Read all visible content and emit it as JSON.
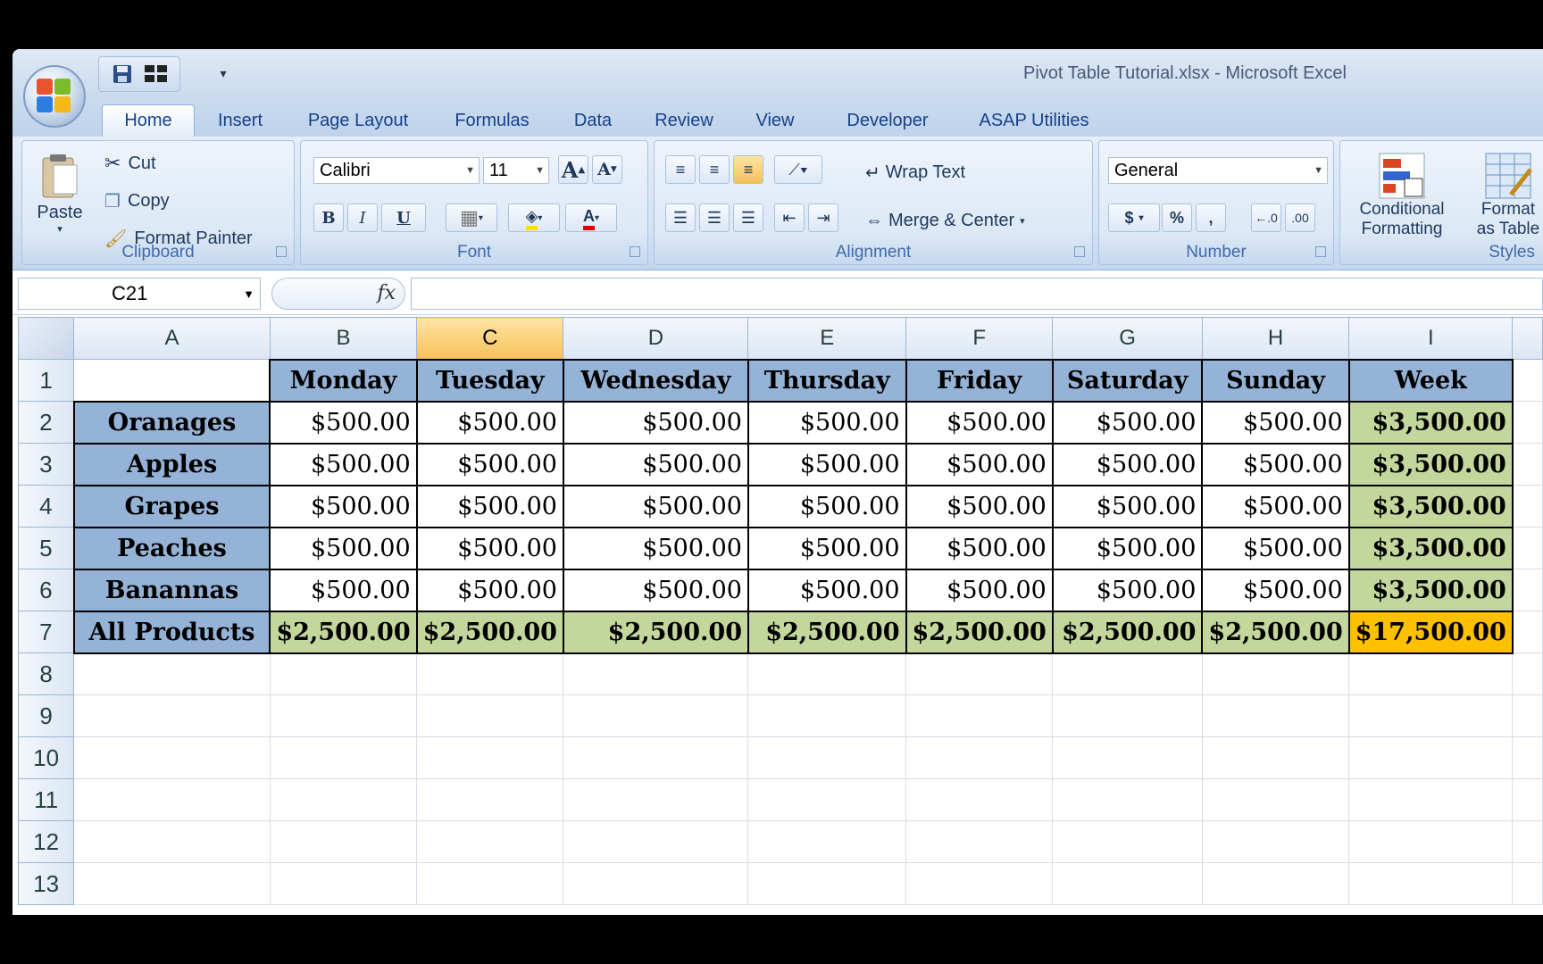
{
  "title": "Pivot Table Tutorial.xlsx - Microsoft Excel",
  "tabs": [
    "Home",
    "Insert",
    "Page Layout",
    "Formulas",
    "Data",
    "Review",
    "View",
    "Developer",
    "ASAP Utilities"
  ],
  "clipboard": {
    "paste": "Paste",
    "cut": "Cut",
    "copy": "Copy",
    "format_painter": "Format Painter",
    "label": "Clipboard"
  },
  "font": {
    "name": "Calibri",
    "size": "11",
    "bold": "B",
    "italic": "I",
    "underline": "U",
    "grow": "A",
    "shrink": "A",
    "label": "Font"
  },
  "alignment": {
    "wrap_text": "Wrap Text",
    "merge_center": "Merge & Center",
    "label": "Alignment"
  },
  "number": {
    "format": "General",
    "currency": "$",
    "percent": "%",
    "comma": ",",
    "label": "Number"
  },
  "styles": {
    "conditional": "Conditional",
    "formatting": "Formatting",
    "format": "Format",
    "as_table": "as Table",
    "label": "Styles"
  },
  "formula_bar": {
    "name_box": "C21",
    "fx": "fx",
    "value": ""
  },
  "columns": [
    "A",
    "B",
    "C",
    "D",
    "E",
    "F",
    "G",
    "H",
    "I"
  ],
  "selected_column": "C",
  "header_row": [
    "",
    "Monday",
    "Tuesday",
    "Wednesday",
    "Thursday",
    "Friday",
    "Saturday",
    "Sunday",
    "Week"
  ],
  "rows": [
    {
      "product": "Oranages",
      "values": [
        "$500.00",
        "$500.00",
        "$500.00",
        "$500.00",
        "$500.00",
        "$500.00",
        "$500.00"
      ],
      "week": "$3,500.00"
    },
    {
      "product": "Apples",
      "values": [
        "$500.00",
        "$500.00",
        "$500.00",
        "$500.00",
        "$500.00",
        "$500.00",
        "$500.00"
      ],
      "week": "$3,500.00"
    },
    {
      "product": "Grapes",
      "values": [
        "$500.00",
        "$500.00",
        "$500.00",
        "$500.00",
        "$500.00",
        "$500.00",
        "$500.00"
      ],
      "week": "$3,500.00"
    },
    {
      "product": "Peaches",
      "values": [
        "$500.00",
        "$500.00",
        "$500.00",
        "$500.00",
        "$500.00",
        "$500.00",
        "$500.00"
      ],
      "week": "$3,500.00"
    },
    {
      "product": "Banannas",
      "values": [
        "$500.00",
        "$500.00",
        "$500.00",
        "$500.00",
        "$500.00",
        "$500.00",
        "$500.00"
      ],
      "week": "$3,500.00"
    }
  ],
  "totals": {
    "product": "All Products",
    "values": [
      "$2,500.00",
      "$2,500.00",
      "$2,500.00",
      "$2,500.00",
      "$2,500.00",
      "$2,500.00",
      "$2,500.00"
    ],
    "week": "$17,500.00"
  },
  "row_numbers": [
    "1",
    "2",
    "3",
    "4",
    "5",
    "6",
    "7",
    "8",
    "9",
    "10",
    "11",
    "12",
    "13"
  ],
  "colors": {
    "header_fill": "#95b3d7",
    "total_fill": "#c3d69b",
    "grand_fill": "#ffc000"
  }
}
